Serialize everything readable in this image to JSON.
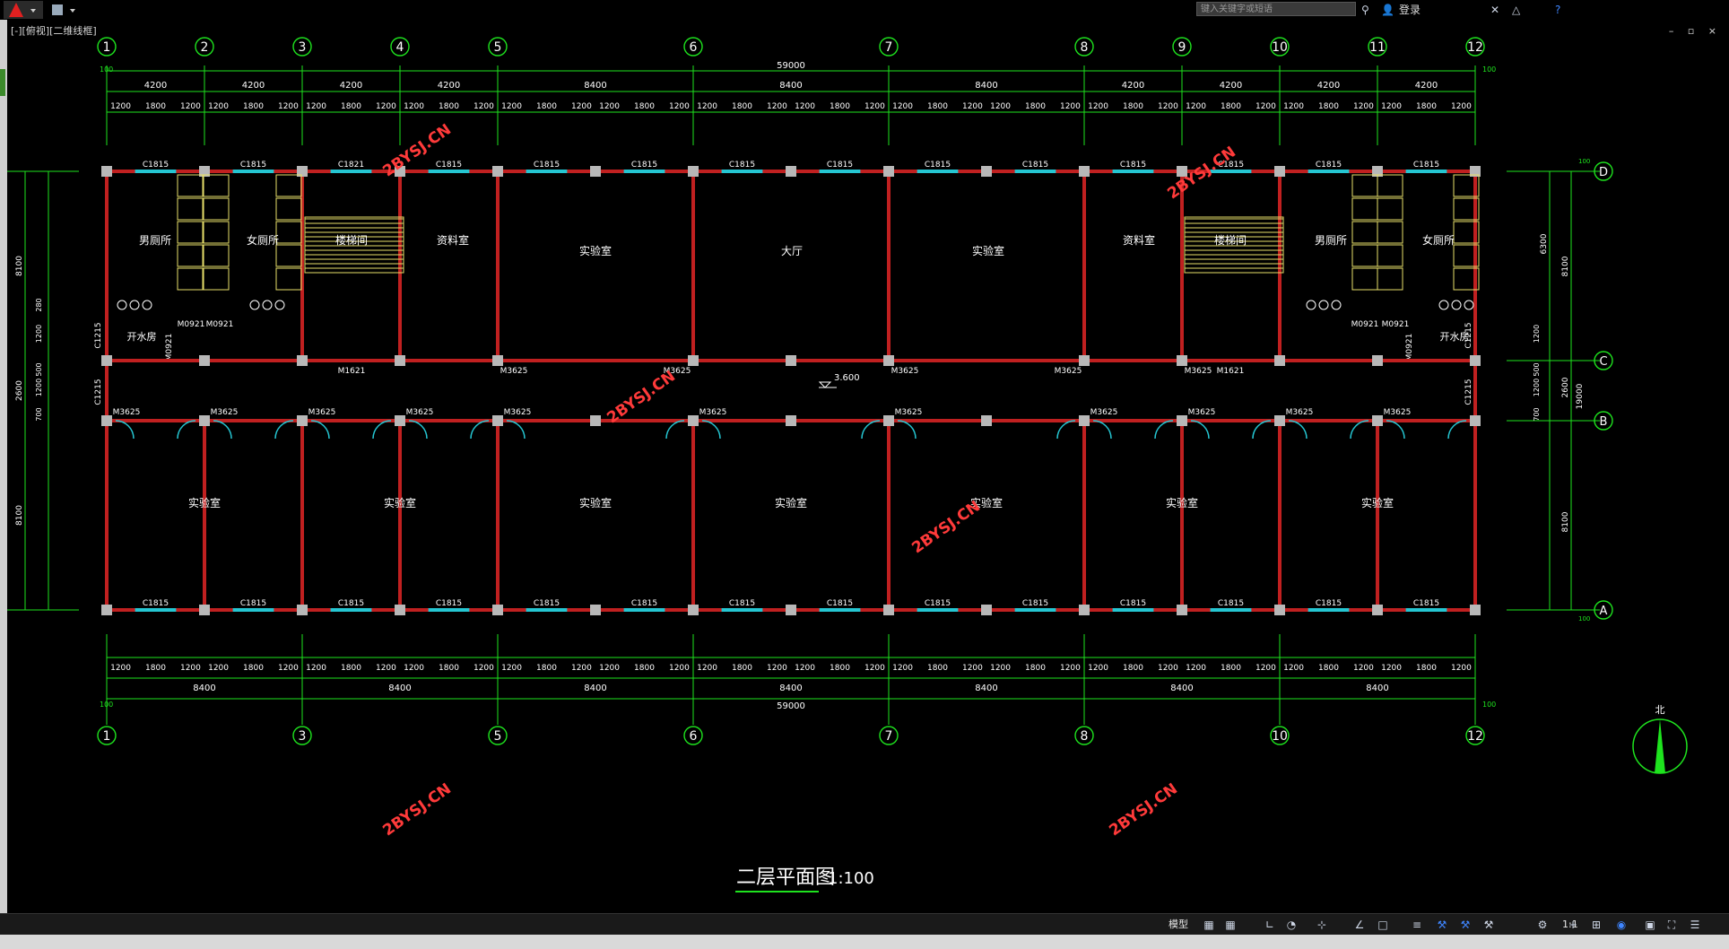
{
  "window": {
    "viewport_label": "[-][俯视][二维线框]",
    "search_placeholder": "键入关键字或短语",
    "login_label": "登录",
    "controls": "– ▫ ×"
  },
  "status": {
    "model_label": "模型",
    "scale_label": "1:1"
  },
  "drawing": {
    "title": "二层平面图",
    "scale": "1:100",
    "north_label": "北",
    "elevation": "3.600",
    "total_length": "59000",
    "total_width": "19000",
    "top_axes": [
      "1",
      "2",
      "3",
      "4",
      "5",
      "6",
      "7",
      "8",
      "9",
      "10",
      "11",
      "12"
    ],
    "bottom_axes": [
      "1",
      "3",
      "5",
      "6",
      "7",
      "8",
      "10",
      "12"
    ],
    "row_axes": [
      "D",
      "C",
      "B",
      "A"
    ],
    "top_bays": [
      "4200",
      "4200",
      "4200",
      "4200",
      "8400",
      "8400",
      "8400",
      "4200",
      "4200",
      "4200",
      "4200"
    ],
    "bottom_bays": [
      "8400",
      "8400",
      "8400",
      "8400",
      "8400",
      "8400",
      "8400"
    ],
    "window_seg": [
      "1200",
      "1800",
      "1200"
    ],
    "edge_mark": "100",
    "left_dims": [
      "8100",
      "2600",
      "8100"
    ],
    "left_sub_dims": [
      "280",
      "1200",
      "500",
      "1200",
      "700"
    ],
    "right_dims": [
      "6300",
      "8100",
      "2600",
      "19000",
      "8100"
    ],
    "right_sub_dims": [
      "1200",
      "500",
      "1200",
      "700"
    ],
    "rooms_north": [
      {
        "label": "男厕所"
      },
      {
        "label": "女厕所"
      },
      {
        "label": "楼梯间"
      },
      {
        "label": "资料室"
      },
      {
        "label": "实验室"
      },
      {
        "label": "大厅"
      },
      {
        "label": "实验室"
      },
      {
        "label": "资料室"
      },
      {
        "label": "楼梯间"
      },
      {
        "label": "男厕所"
      },
      {
        "label": "女厕所"
      }
    ],
    "small_rooms": [
      "开水房",
      "开水房"
    ],
    "rooms_south": [
      "实验室",
      "实验室",
      "实验室",
      "实验室",
      "实验室",
      "实验室",
      "实验室"
    ],
    "window_codes": {
      "c1815": "C1815",
      "c1821": "C1821",
      "c1215": "C1215"
    },
    "door_codes": {
      "m3625": "M3625",
      "m1621": "M1621",
      "m0921": "M0921"
    },
    "watermark": "2BYSJ.CN"
  },
  "colors": {
    "axis_green": "#1ee31e",
    "text_white": "#ffffff",
    "wall_red": "#c02020",
    "window_cyan": "#25c6d2",
    "fixture_yellow": "#e8e06a",
    "column_gray": "#b8b8b8",
    "watermark_red": "#ff3a3a"
  }
}
